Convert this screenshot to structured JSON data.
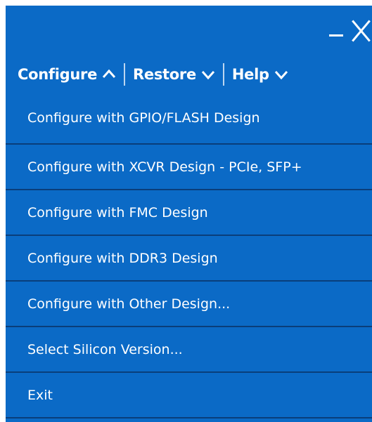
{
  "window_controls": {
    "minimize_icon": "minimize-icon",
    "close_icon": "close-icon"
  },
  "menubar": {
    "menus": [
      {
        "label": "Configure",
        "state": "expanded",
        "icon": "chevron-up-icon"
      },
      {
        "label": "Restore",
        "state": "collapsed",
        "icon": "chevron-down-icon"
      },
      {
        "label": "Help",
        "state": "collapsed",
        "icon": "chevron-down-icon"
      }
    ]
  },
  "configure_menu": {
    "items": [
      {
        "label": "Configure with GPIO/FLASH Design"
      },
      {
        "label": "Configure with XCVR Design -  PCIe, SFP+"
      },
      {
        "label": "Configure with FMC Design"
      },
      {
        "label": "Configure with DDR3 Design"
      },
      {
        "label": "Configure with Other Design..."
      },
      {
        "label": "Select Silicon Version..."
      },
      {
        "label": "Exit"
      }
    ]
  },
  "colors": {
    "background": "#0b6ac6",
    "text": "#ffffff",
    "divider": "#0a3e7a",
    "separator": "#bcd6f0"
  }
}
